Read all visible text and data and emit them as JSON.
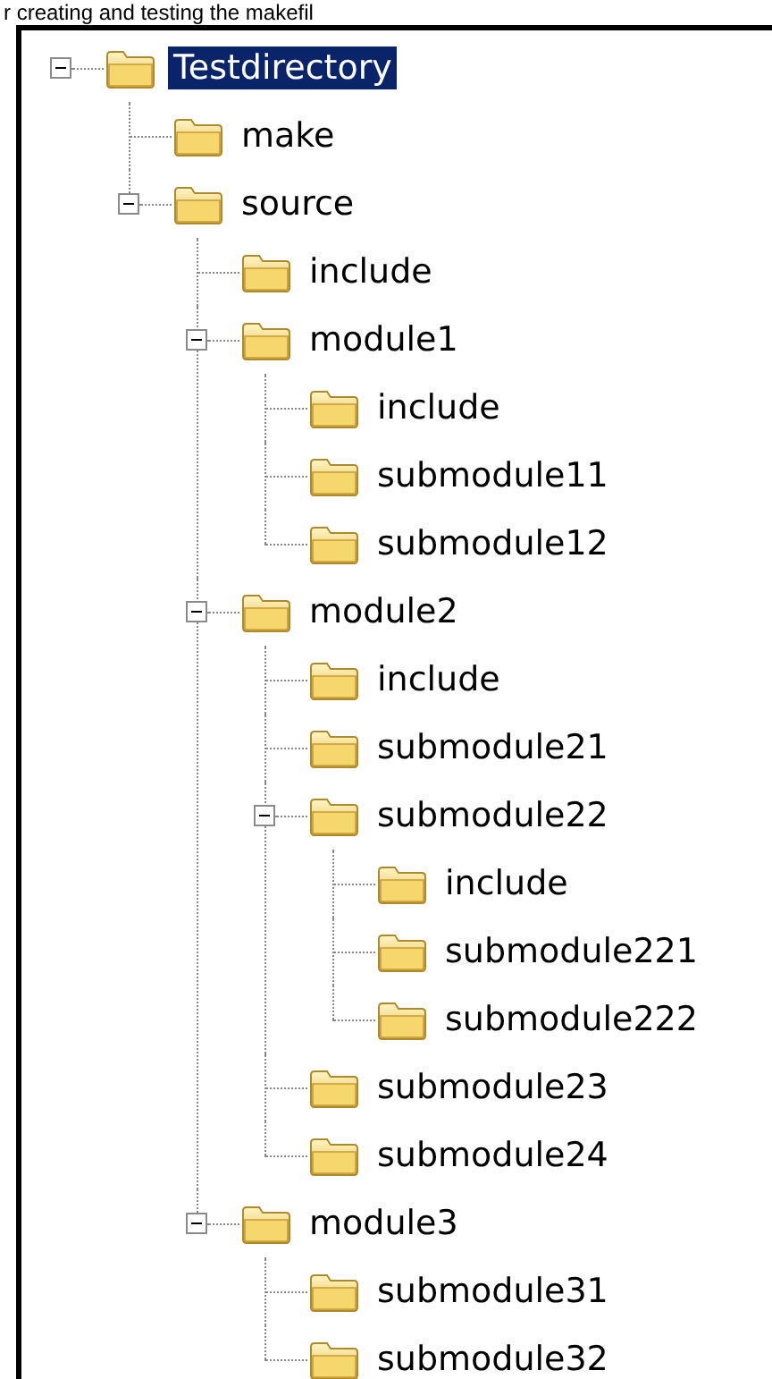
{
  "caption": "r creating and testing the makefil",
  "tree": [
    {
      "label": "Testdirectory",
      "selected": true,
      "expanded": true,
      "children": [
        {
          "label": "make",
          "selected": false
        },
        {
          "label": "source",
          "selected": false,
          "expanded": true,
          "children": [
            {
              "label": "include",
              "selected": false
            },
            {
              "label": "module1",
              "selected": false,
              "expanded": true,
              "children": [
                {
                  "label": "include",
                  "selected": false
                },
                {
                  "label": "submodule11",
                  "selected": false
                },
                {
                  "label": "submodule12",
                  "selected": false
                }
              ]
            },
            {
              "label": "module2",
              "selected": false,
              "expanded": true,
              "children": [
                {
                  "label": "include",
                  "selected": false
                },
                {
                  "label": "submodule21",
                  "selected": false
                },
                {
                  "label": "submodule22",
                  "selected": false,
                  "expanded": true,
                  "children": [
                    {
                      "label": "include",
                      "selected": false
                    },
                    {
                      "label": "submodule221",
                      "selected": false
                    },
                    {
                      "label": "submodule222",
                      "selected": false
                    }
                  ]
                },
                {
                  "label": "submodule23",
                  "selected": false
                },
                {
                  "label": "submodule24",
                  "selected": false
                }
              ]
            },
            {
              "label": "module3",
              "selected": false,
              "expanded": true,
              "children": [
                {
                  "label": "submodule31",
                  "selected": false
                },
                {
                  "label": "submodule32",
                  "selected": false
                }
              ]
            }
          ]
        }
      ]
    }
  ]
}
